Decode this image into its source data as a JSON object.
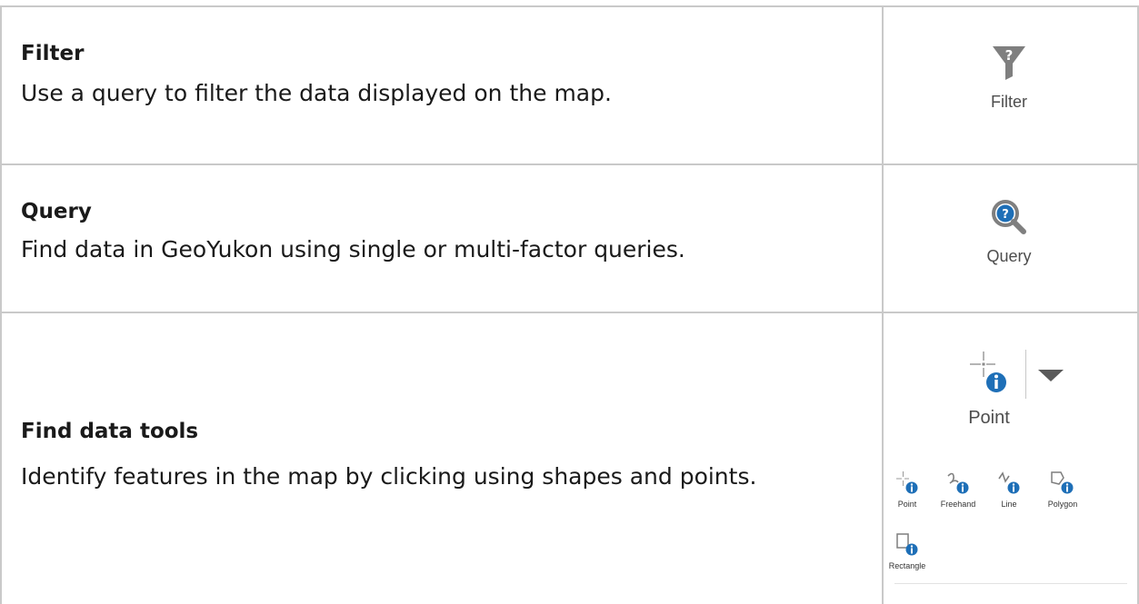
{
  "rows": [
    {
      "title": "Filter",
      "description": "Use a query to filter the data displayed on the map.",
      "tool_label": "Filter",
      "icon": "filter-funnel-icon"
    },
    {
      "title": "Query",
      "description": "Find data in GeoYukon using single or multi-factor queries.",
      "tool_label": "Query",
      "icon": "query-magnifier-icon"
    },
    {
      "title": "Find data tools",
      "description": "Identify features in the map by clicking using shapes and points.",
      "tool_label": "Point",
      "icon": "point-info-icon",
      "gallery": [
        {
          "label": "Point",
          "icon": "point-info-icon"
        },
        {
          "label": "Freehand",
          "icon": "freehand-info-icon"
        },
        {
          "label": "Line",
          "icon": "line-info-icon"
        },
        {
          "label": "Polygon",
          "icon": "polygon-info-icon"
        },
        {
          "label": "Rectangle",
          "icon": "rectangle-info-icon"
        }
      ]
    }
  ],
  "colors": {
    "border": "#c9c9c9",
    "icon_gray": "#7f7f7f",
    "info_blue": "#1e6fb7"
  }
}
